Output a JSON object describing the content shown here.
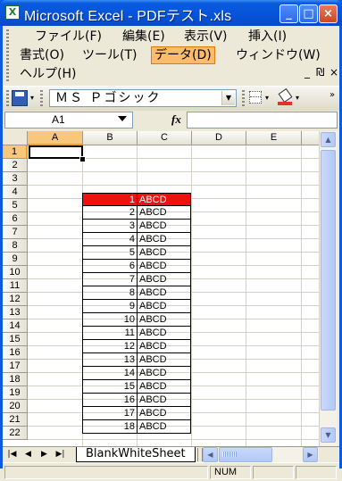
{
  "window": {
    "title": "Microsoft Excel - PDFテスト.xls",
    "app_icon": "X",
    "buttons": {
      "minimize": "_",
      "maximize": "□",
      "close": "×"
    }
  },
  "menu": {
    "items": [
      {
        "label": "ファイル(F)"
      },
      {
        "label": "編集(E)"
      },
      {
        "label": "表示(V)"
      },
      {
        "label": "挿入(I)"
      },
      {
        "label": "書式(O)"
      },
      {
        "label": "ツール(T)"
      },
      {
        "label": "データ(D)"
      },
      {
        "label": "ウィンドウ(W)"
      },
      {
        "label": "ヘルプ(H)"
      }
    ],
    "active_item": "データ(D)",
    "doc_controls": {
      "minimize": "_",
      "restore": "₪",
      "close": "×"
    }
  },
  "toolbar": {
    "font_name": "ＭＳ Ｐゴシック",
    "icons": [
      "save-icon",
      "borders-icon",
      "fill-color-icon"
    ],
    "fill_color": "#e8302a"
  },
  "formula_bar": {
    "name_box": "A1",
    "fx_label": "fx",
    "formula": ""
  },
  "grid": {
    "columns": [
      "A",
      "B",
      "C",
      "D",
      "E"
    ],
    "rows": [
      "1",
      "2",
      "3",
      "4",
      "5",
      "6",
      "7",
      "8",
      "9",
      "10",
      "11",
      "12",
      "13",
      "14",
      "15",
      "16",
      "17",
      "18",
      "19",
      "20",
      "21",
      "22"
    ],
    "selected_cell": "A1",
    "table": [
      {
        "b": "1",
        "c": "ABCD"
      },
      {
        "b": "2",
        "c": "ABCD"
      },
      {
        "b": "3",
        "c": "ABCD"
      },
      {
        "b": "4",
        "c": "ABCD"
      },
      {
        "b": "5",
        "c": "ABCD"
      },
      {
        "b": "6",
        "c": "ABCD"
      },
      {
        "b": "7",
        "c": "ABCD"
      },
      {
        "b": "8",
        "c": "ABCD"
      },
      {
        "b": "9",
        "c": "ABCD"
      },
      {
        "b": "10",
        "c": "ABCD"
      },
      {
        "b": "11",
        "c": "ABCD"
      },
      {
        "b": "12",
        "c": "ABCD"
      },
      {
        "b": "13",
        "c": "ABCD"
      },
      {
        "b": "14",
        "c": "ABCD"
      },
      {
        "b": "15",
        "c": "ABCD"
      },
      {
        "b": "16",
        "c": "ABCD"
      },
      {
        "b": "17",
        "c": "ABCD"
      },
      {
        "b": "18",
        "c": "ABCD"
      }
    ],
    "highlight_color": "#f01010"
  },
  "sheet_tabs": {
    "nav": [
      "|◀",
      "◀",
      "▶",
      "▶|"
    ],
    "tabs": [
      "BlankWhiteSheet"
    ]
  },
  "status_bar": {
    "mode": "",
    "num_indicator": "NUM"
  }
}
